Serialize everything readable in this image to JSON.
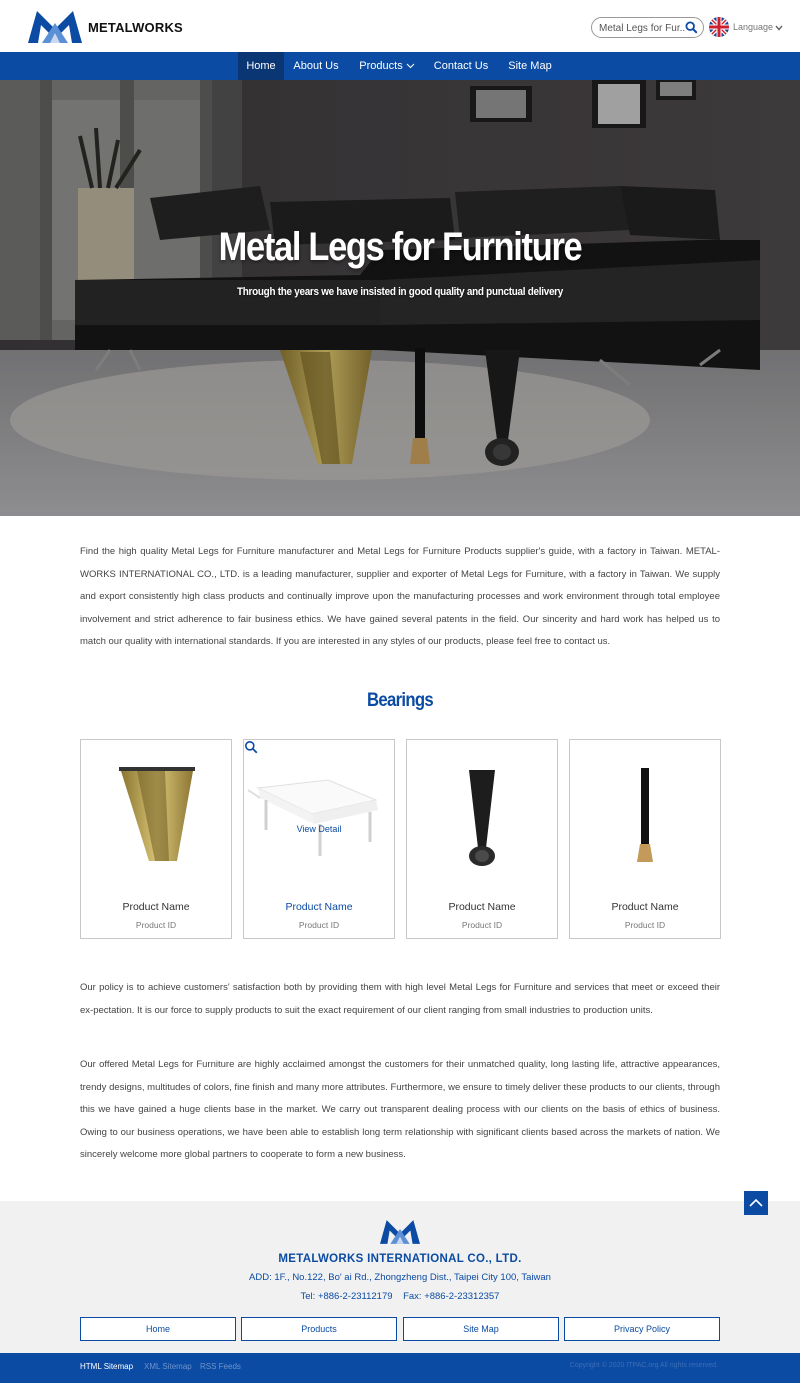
{
  "header": {
    "brand": "METALWORKS",
    "search_value": "Metal Legs for Fur...",
    "language_label": "Language",
    "icons": {
      "search": "search-icon",
      "flag": "uk-flag-icon",
      "chevron": "chevron-down-icon"
    }
  },
  "nav": {
    "items": [
      {
        "label": "Home",
        "active": true
      },
      {
        "label": "About Us",
        "active": false
      },
      {
        "label": "Products",
        "active": false
      },
      {
        "label": "Contact Us",
        "active": false
      },
      {
        "label": "Site Map",
        "active": false
      }
    ]
  },
  "hero": {
    "title": "Metal Legs for Furniture",
    "subtitle": "Through the years we have insisted in good quality and punctual delivery"
  },
  "intro": {
    "text": "Find the high quality Metal Legs for Furniture manufacturer and Metal Legs for Furniture Products supplier's guide, with a factory in Taiwan. METAL-WORKS INTERNATIONAL CO., LTD. is a leading manufacturer, supplier and exporter of Metal Legs for Furniture, with a factory in Taiwan. We supply and export consistently high class products and continually improve upon the manufacturing processes and work environment through total employee involvement and strict adherence to fair business ethics. We have gained several patents in the field. Our sincerity and hard work has helped us to match our quality with international standards. If you are interested in any styles of our products, please feel free to contact us."
  },
  "products": {
    "section_title": "Bearings",
    "view_detail_label": "View Detail",
    "items": [
      {
        "name": "Product Name",
        "id": "Product ID",
        "highlighted": false
      },
      {
        "name": "Product Name",
        "id": "Product ID",
        "highlighted": true
      },
      {
        "name": "Product Name",
        "id": "Product ID",
        "highlighted": false
      },
      {
        "name": "Product Name",
        "id": "Product ID",
        "highlighted": false
      }
    ]
  },
  "policy": {
    "text": "Our policy is to achieve customers' satisfaction both by providing them with high level Metal Legs for Furniture and services that meet or exceed their ex-pectation. It is our force to supply products to suit the exact requirement of our client ranging from small industries to production units."
  },
  "offered": {
    "text": "Our offered Metal Legs for Furniture are highly acclaimed amongst the customers for their unmatched quality, long lasting life, attractive appearances, trendy designs, multitudes of colors, fine finish and many more attributes. Furthermore, we ensure to timely deliver these products to our clients, through this we have gained a huge clients base in the market. We carry out transparent dealing process with our clients on the basis of ethics of business. Owing to our business operations, we have been able to establish long term relationship with significant clients based across the markets of nation. We sincerely welcome more global partners to cooperate to form a new business."
  },
  "footer": {
    "company": "METALWORKS INTERNATIONAL CO., LTD.",
    "address": "ADD: 1F., No.122, Bo' ai Rd., Zhongzheng Dist., Taipei City 100, Taiwan",
    "tel": "Tel: +886-2-23112179",
    "fax": "Fax: +886-2-23312357",
    "buttons": [
      "Home",
      "Products",
      "Site Map",
      "Privacy Policy"
    ],
    "bottom_links": [
      "HTML Sitemap",
      "XML Sitemap",
      "RSS Feeds"
    ],
    "copyright": "Copyright © 2020 ITPAC.org All rights reserved."
  },
  "colors": {
    "brand_blue": "#0b4ba3",
    "nav_active": "#0a3673",
    "footer_bg": "#f1f1f1"
  }
}
